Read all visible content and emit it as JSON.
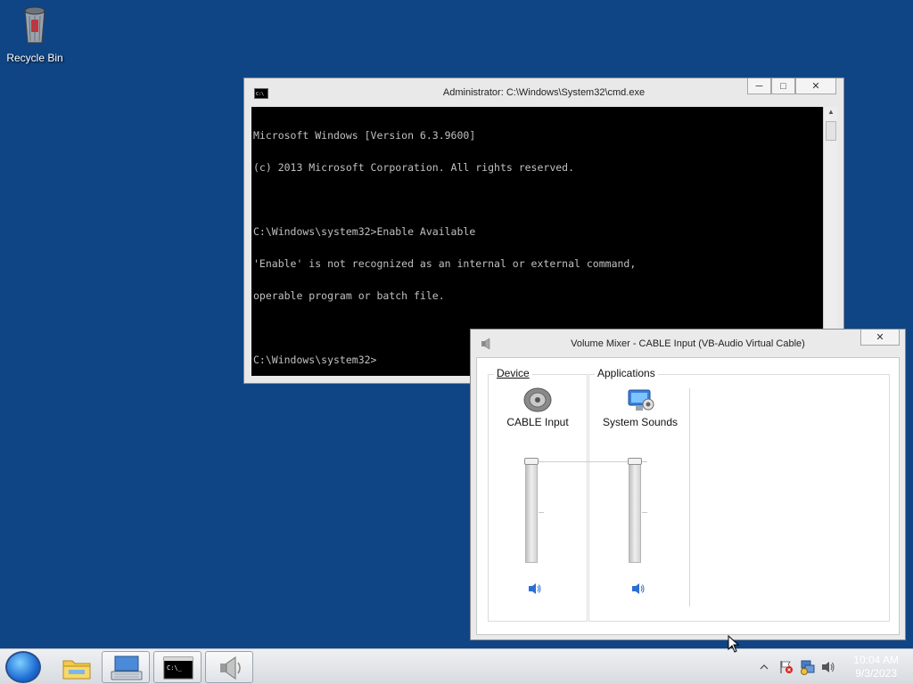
{
  "desktop": {
    "recycle_bin_label": "Recycle Bin",
    "background_color": "#0f4585"
  },
  "cmd_window": {
    "title": "Administrator: C:\\Windows\\System32\\cmd.exe",
    "console_lines": [
      "Microsoft Windows [Version 6.3.9600]",
      "(c) 2013 Microsoft Corporation. All rights reserved.",
      "",
      "C:\\Windows\\system32>Enable Available",
      "'Enable' is not recognized as an internal or external command,",
      "operable program or batch file.",
      "",
      "C:\\Windows\\system32>"
    ],
    "controls": {
      "minimize": "─",
      "maximize": "□",
      "close": "✕"
    }
  },
  "volume_mixer": {
    "title": "Volume Mixer - CABLE Input (VB-Audio Virtual Cable)",
    "close": "✕",
    "device_group_label": "Device",
    "applications_group_label": "Applications",
    "channels": [
      {
        "name": "CABLE Input",
        "icon": "speaker-device-icon",
        "volume_level": 1.0,
        "muted": false
      },
      {
        "name": "System Sounds",
        "icon": "system-sounds-icon",
        "volume_level": 1.0,
        "muted": false
      }
    ]
  },
  "taskbar": {
    "items": [
      {
        "icon": "start-orb-icon"
      },
      {
        "icon": "file-explorer-icon"
      },
      {
        "icon": "keyboard-monitor-icon"
      },
      {
        "icon": "command-prompt-icon"
      },
      {
        "icon": "volume-mixer-icon"
      }
    ],
    "tray_icons": [
      "show-hidden-icons-arrow",
      "action-center-flag-icon",
      "network-icon",
      "volume-icon"
    ],
    "clock_time": "10:04 AM",
    "clock_date": "9/3/2023"
  }
}
